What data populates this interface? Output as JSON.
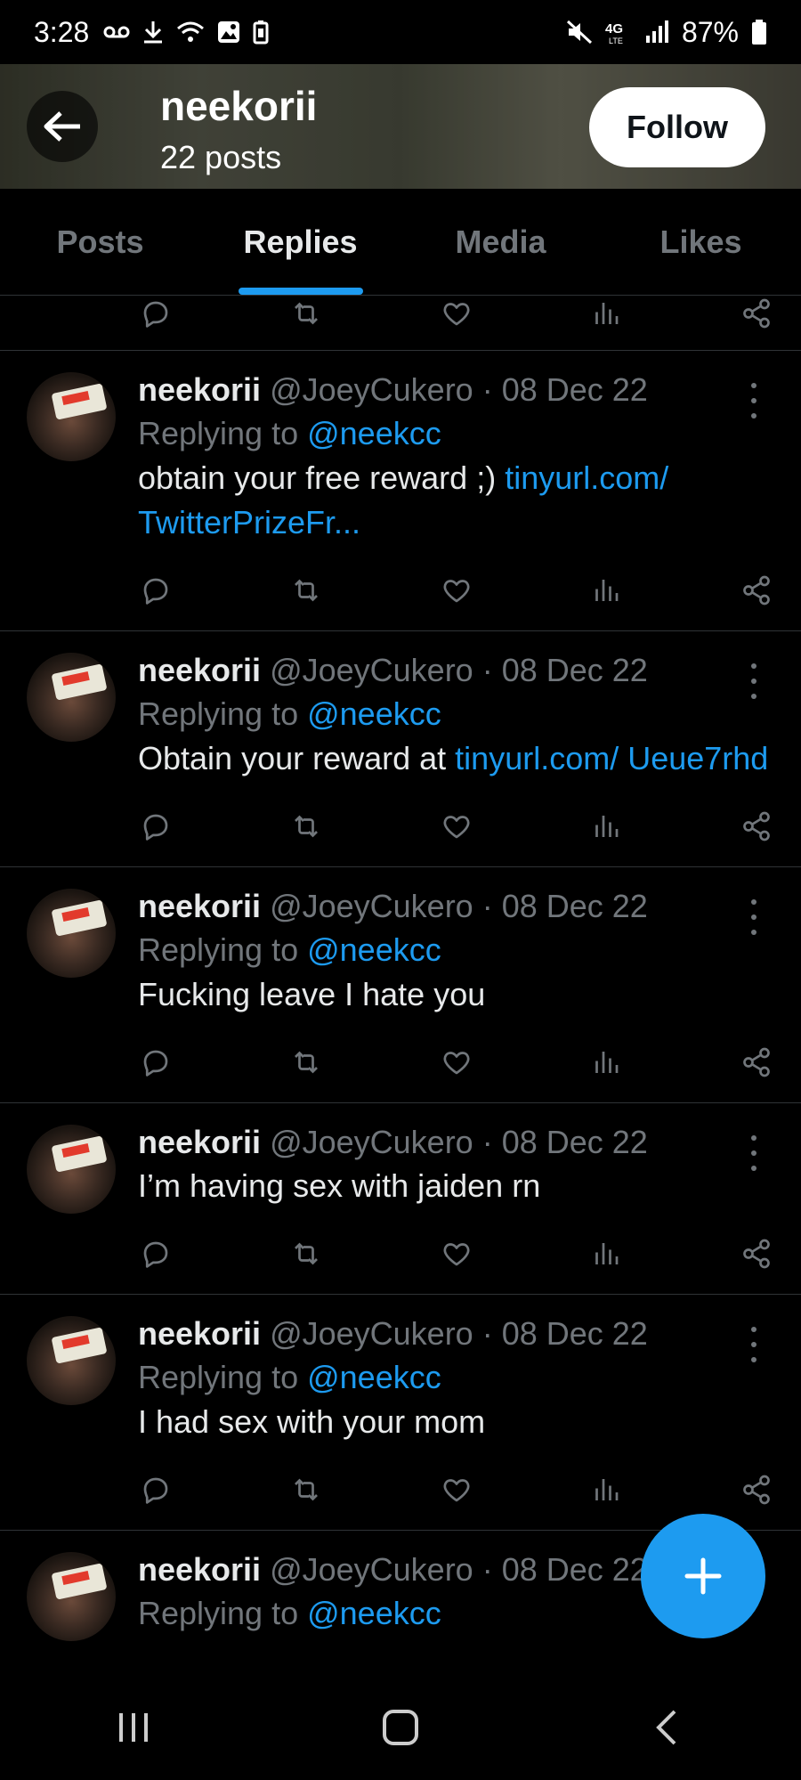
{
  "status_bar": {
    "time": "3:28",
    "battery": "87%",
    "left_icons": [
      "voicemail-icon",
      "download-icon",
      "wifi-icon",
      "gallery-icon",
      "battery-saver-icon"
    ],
    "right_icons": [
      "mute-icon",
      "4g-lte-icon",
      "signal-icon",
      "battery-icon"
    ]
  },
  "header": {
    "name": "neekorii",
    "posts": "22 posts",
    "follow_label": "Follow"
  },
  "tabs": [
    {
      "label": "Posts",
      "active": false
    },
    {
      "label": "Replies",
      "active": true
    },
    {
      "label": "Media",
      "active": false
    },
    {
      "label": "Likes",
      "active": false
    }
  ],
  "tweets": [
    {
      "name": "neekorii",
      "meta": "@JoeyCukero · 08 Dec 22",
      "replying_prefix": "Replying to ",
      "mention": "@neekcc",
      "text": "obtain your free reward ;) ",
      "link": "tinyurl.com/ TwitterPrizeFr..."
    },
    {
      "name": "neekorii",
      "meta": "@JoeyCukero · 08 Dec 22",
      "replying_prefix": "Replying to ",
      "mention": "@neekcc",
      "text": "Obtain your reward at ",
      "link": "tinyurl.com/ Ueue7rhd"
    },
    {
      "name": "neekorii",
      "meta": "@JoeyCukero · 08 Dec 22",
      "replying_prefix": "Replying to ",
      "mention": "@neekcc",
      "text": "Fucking leave I hate you",
      "link": ""
    },
    {
      "name": "neekorii",
      "meta": "@JoeyCukero · 08 Dec 22",
      "replying_prefix": "",
      "mention": "",
      "text": "I’m having sex with jaiden rn",
      "link": ""
    },
    {
      "name": "neekorii",
      "meta": "@JoeyCukero · 08 Dec 22",
      "replying_prefix": "Replying to ",
      "mention": "@neekcc",
      "text": "I had sex with your mom",
      "link": ""
    },
    {
      "name": "neekorii",
      "meta": "@JoeyCukero · 08 Dec 22",
      "replying_prefix": "Replying to ",
      "mention": "@neekcc",
      "text": "",
      "link": ""
    }
  ],
  "colors": {
    "accent": "#1d9bf0",
    "background": "#000000",
    "secondary_text": "#71767b",
    "divider": "#2f3336"
  }
}
